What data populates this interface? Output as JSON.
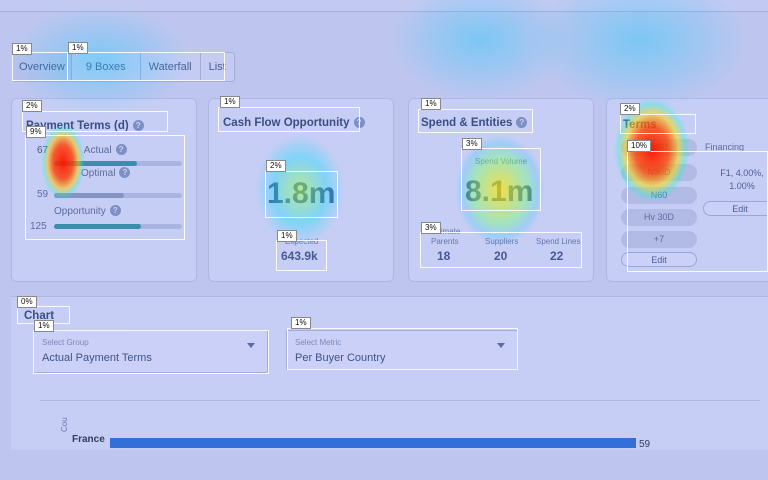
{
  "tabs": [
    {
      "label": "Overview",
      "pct": "1%"
    },
    {
      "label": "9 Boxes",
      "pct": "1%"
    },
    {
      "label": "Waterfall"
    },
    {
      "label": "List"
    }
  ],
  "payment_terms": {
    "title": "Payment Terms (d)",
    "title_pct": "2%",
    "group_pct": "9%",
    "rows": [
      {
        "label": "Actual",
        "value": "67",
        "fill": 0.65
      },
      {
        "label": "Optimal",
        "value": "59",
        "fill": 0.55
      },
      {
        "label": "Opportunity",
        "value": "125",
        "fill": 0.68
      }
    ]
  },
  "cash_flow": {
    "title": "Cash Flow Opportunity",
    "title_pct": "1%",
    "value": "1.8m",
    "value_pct": "2%",
    "sub_label": "Expected",
    "sub_value": "643.9k",
    "sub_pct": "1%"
  },
  "spend": {
    "title": "Spend & Entities",
    "title_pct": "1%",
    "volume_label": "Spend Volume",
    "volume_value": "8.1m",
    "volume_pct": "3%",
    "entities_title": "Ultimate",
    "entities_pct": "3%",
    "entities": [
      {
        "label": "Parents",
        "value": "18"
      },
      {
        "label": "Suppliers",
        "value": "20"
      },
      {
        "label": "Spend Lines",
        "value": "22"
      }
    ]
  },
  "terms_card": {
    "title": "Terms",
    "title_pct": "2%",
    "group_pct": "10%",
    "pills": [
      "N60",
      "N30D",
      "N60",
      "N60",
      "Hv 30D"
    ],
    "more": "+7",
    "edit_label": "Edit",
    "financing_label": "Financing",
    "financing_value": "F1, 4.00%, 1.00%",
    "financing_edit": "Edit"
  },
  "chart_section": {
    "title": "Chart",
    "title_pct": "0%",
    "group_select": {
      "label": "Select Group",
      "value": "Actual Payment Terms",
      "pct": "1%"
    },
    "metric_select": {
      "label": "Select Metric",
      "value": "Per Buyer Country",
      "pct": "1%"
    }
  },
  "chart_data": {
    "type": "bar",
    "categories": [
      "France"
    ],
    "values": [
      59
    ],
    "ylabel": "Cou",
    "colors": [
      "#1f6fd1"
    ]
  }
}
